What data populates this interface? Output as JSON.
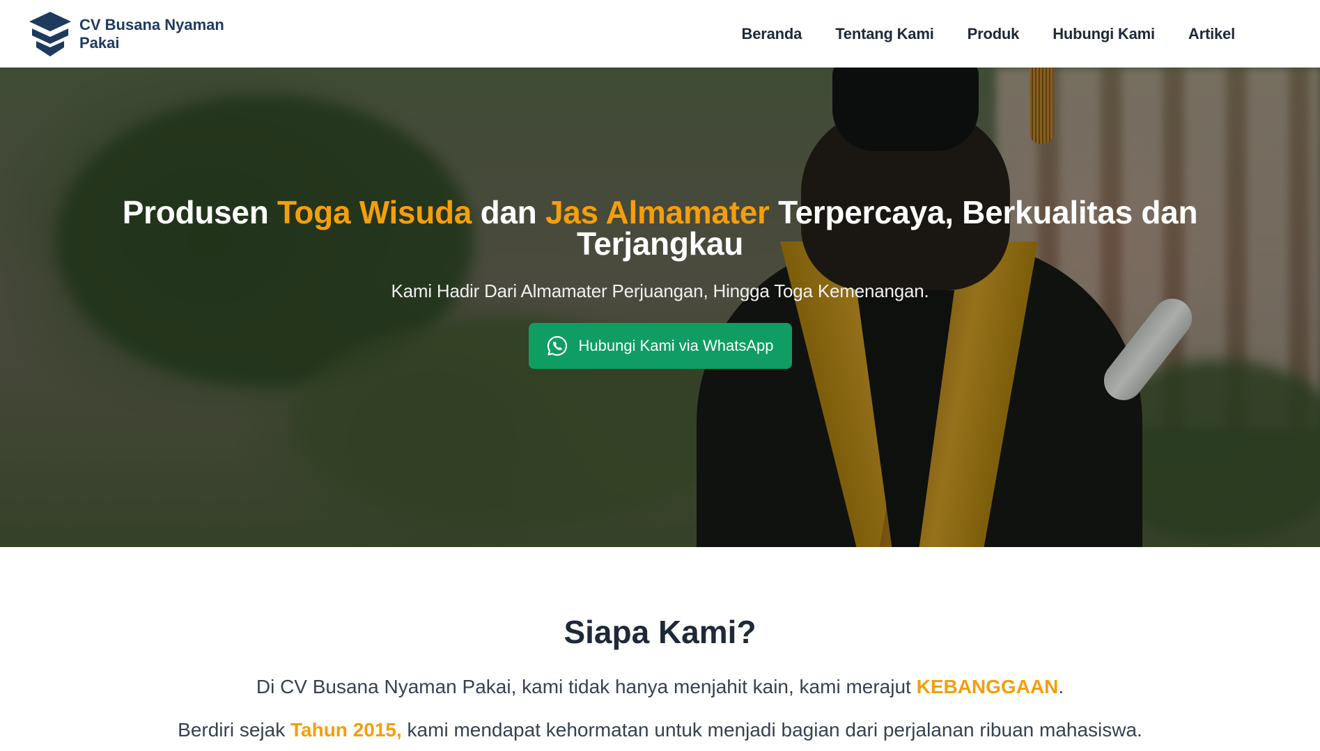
{
  "brand": {
    "name": "CV Busana Nyaman Pakai",
    "logo_icon": "stacked-chevron-logo-icon",
    "color": "#1e3a5f"
  },
  "nav": {
    "items": [
      {
        "label": "Beranda"
      },
      {
        "label": "Tentang Kami"
      },
      {
        "label": "Produk"
      },
      {
        "label": "Hubungi Kami"
      },
      {
        "label": "Artikel"
      }
    ]
  },
  "hero": {
    "title_parts": {
      "p1": "Produsen ",
      "accent1": "Toga Wisuda",
      "p2": " dan ",
      "accent2": "Jas Almamater",
      "p3": " Terpercaya, Berkualitas dan Terjangkau"
    },
    "subtitle": "Kami Hadir Dari Almamater Perjuangan, Hingga Toga Kemenangan.",
    "cta_label": "Hubungi Kami via WhatsApp",
    "cta_icon": "whatsapp-icon",
    "accent_color": "#f59e0b",
    "cta_color": "#0f9d63"
  },
  "about": {
    "title": "Siapa Kami?",
    "p1_before": "Di CV Busana Nyaman Pakai, kami tidak hanya menjahit kain, kami merajut ",
    "p1_highlight": "KEBANGGAAN",
    "p1_after": ".",
    "p2_before": "Berdiri sejak ",
    "p2_highlight": "Tahun 2015,",
    "p2_after": " kami mendapat kehormatan untuk menjadi bagian dari perjalanan ribuan mahasiswa."
  }
}
